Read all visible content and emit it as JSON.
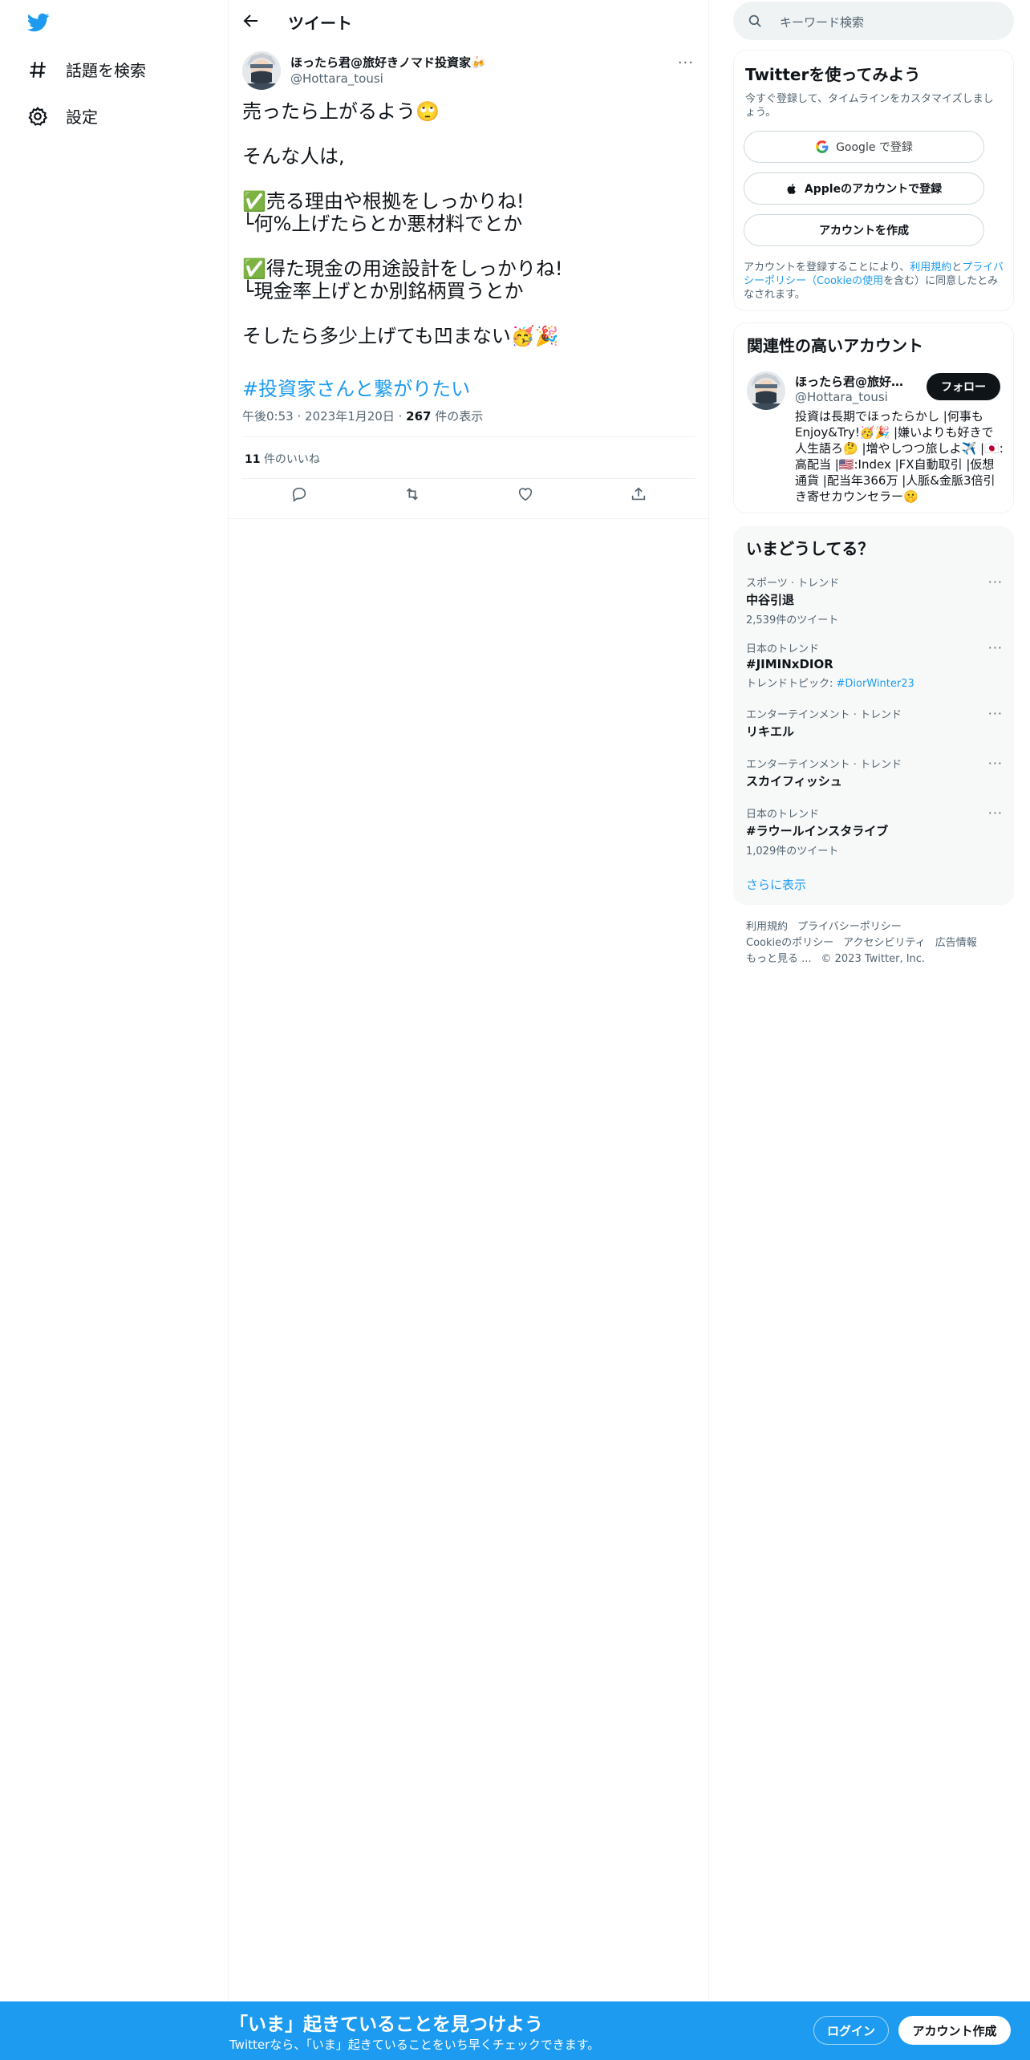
{
  "sidebar": {
    "logo": "twitter-bird",
    "items": [
      {
        "label": "話題を検索",
        "icon": "hashtag-icon"
      },
      {
        "label": "設定",
        "icon": "gear-icon"
      }
    ]
  },
  "header": {
    "title": "ツイート"
  },
  "tweet": {
    "author_name": "ほったら君@旅好きノマド投資家🍻",
    "author_handle": "@Hottara_tousi",
    "body": "売ったら上がるよう🙄\n\nそんな人は,\n\n✅売る理由や根拠をしっかりね!\n└何%上げたらとか悪材料でとか\n\n✅得た現金の用途設計をしっかりね!\n└現金率上げとか別銘柄買うとか\n\nそしたら多少上げても凹まない🥳🎉",
    "hashtag": "#投資家さんと繋がりたい",
    "time": "午後0:53",
    "date": "2023年1月20日",
    "views_count": "267",
    "views_label": "件の表示",
    "likes_count": "11",
    "likes_label": "件のいいね"
  },
  "search": {
    "placeholder": "キーワード検索"
  },
  "signup_card": {
    "title": "Twitterを使ってみよう",
    "subtitle": "今すぐ登録して、タイムラインをカスタマイズしましょう。",
    "google": "Google で登録",
    "apple": "Appleのアカウントで登録",
    "create": "アカウントを作成",
    "terms_pre": "アカウントを登録することにより、",
    "terms_link1": "利用規約",
    "terms_mid": "と",
    "terms_link2": "プライバシーポリシー（Cookieの使用",
    "terms_post": "を含む）に同意したとみなされます。"
  },
  "related": {
    "title": "関連性の高いアカウント",
    "name": "ほったら君@旅好きノマド投資家🍻",
    "handle": "@Hottara_tousi",
    "follow": "フォロー",
    "bio": "投資は長期でほったらかし |何事もEnjoy&Try!🥳🎉 |嫌いよりも好きで人生語ろ🤔 |増やしつつ旅しよ✈️ |🇯🇵:高配当 |🇺🇸:Index |FX自動取引 |仮想通貨 |配当年366万 |人脈&金脈3倍引き寄せカウンセラー🤫"
  },
  "trends": {
    "title": "いまどうしてる？",
    "items": [
      {
        "context": "スポーツ · トレンド",
        "name": "中谷引退",
        "sub": "2,539件のツイート",
        "topic": ""
      },
      {
        "context": "日本のトレンド",
        "name": "#JIMINxDIOR",
        "sub": "トレンドトピック: ",
        "topic": "#DiorWinter23"
      },
      {
        "context": "エンターテインメント · トレンド",
        "name": "リキエル",
        "sub": "",
        "topic": ""
      },
      {
        "context": "エンターテインメント · トレンド",
        "name": "スカイフィッシュ",
        "sub": "",
        "topic": ""
      },
      {
        "context": "日本のトレンド",
        "name": "#ラウールインスタライブ",
        "sub": "1,029件のツイート",
        "topic": ""
      }
    ],
    "show_more": "さらに表示"
  },
  "footer": {
    "links": [
      "利用規約",
      "プライバシーポリシー",
      "Cookieのポリシー",
      "アクセシビリティ",
      "広告情報",
      "もっと見る ..."
    ],
    "copyright": "© 2023 Twitter, Inc."
  },
  "bottom_bar": {
    "title": "「いま」起きていることを見つけよう",
    "subtitle": "Twitterなら、「いま」起きていることをいち早くチェックできます。",
    "login": "ログイン",
    "signup": "アカウント作成"
  },
  "colors": {
    "accent": "#1d9bf0",
    "text": "#0f1419",
    "muted": "#536471",
    "border": "#eff3f4"
  }
}
